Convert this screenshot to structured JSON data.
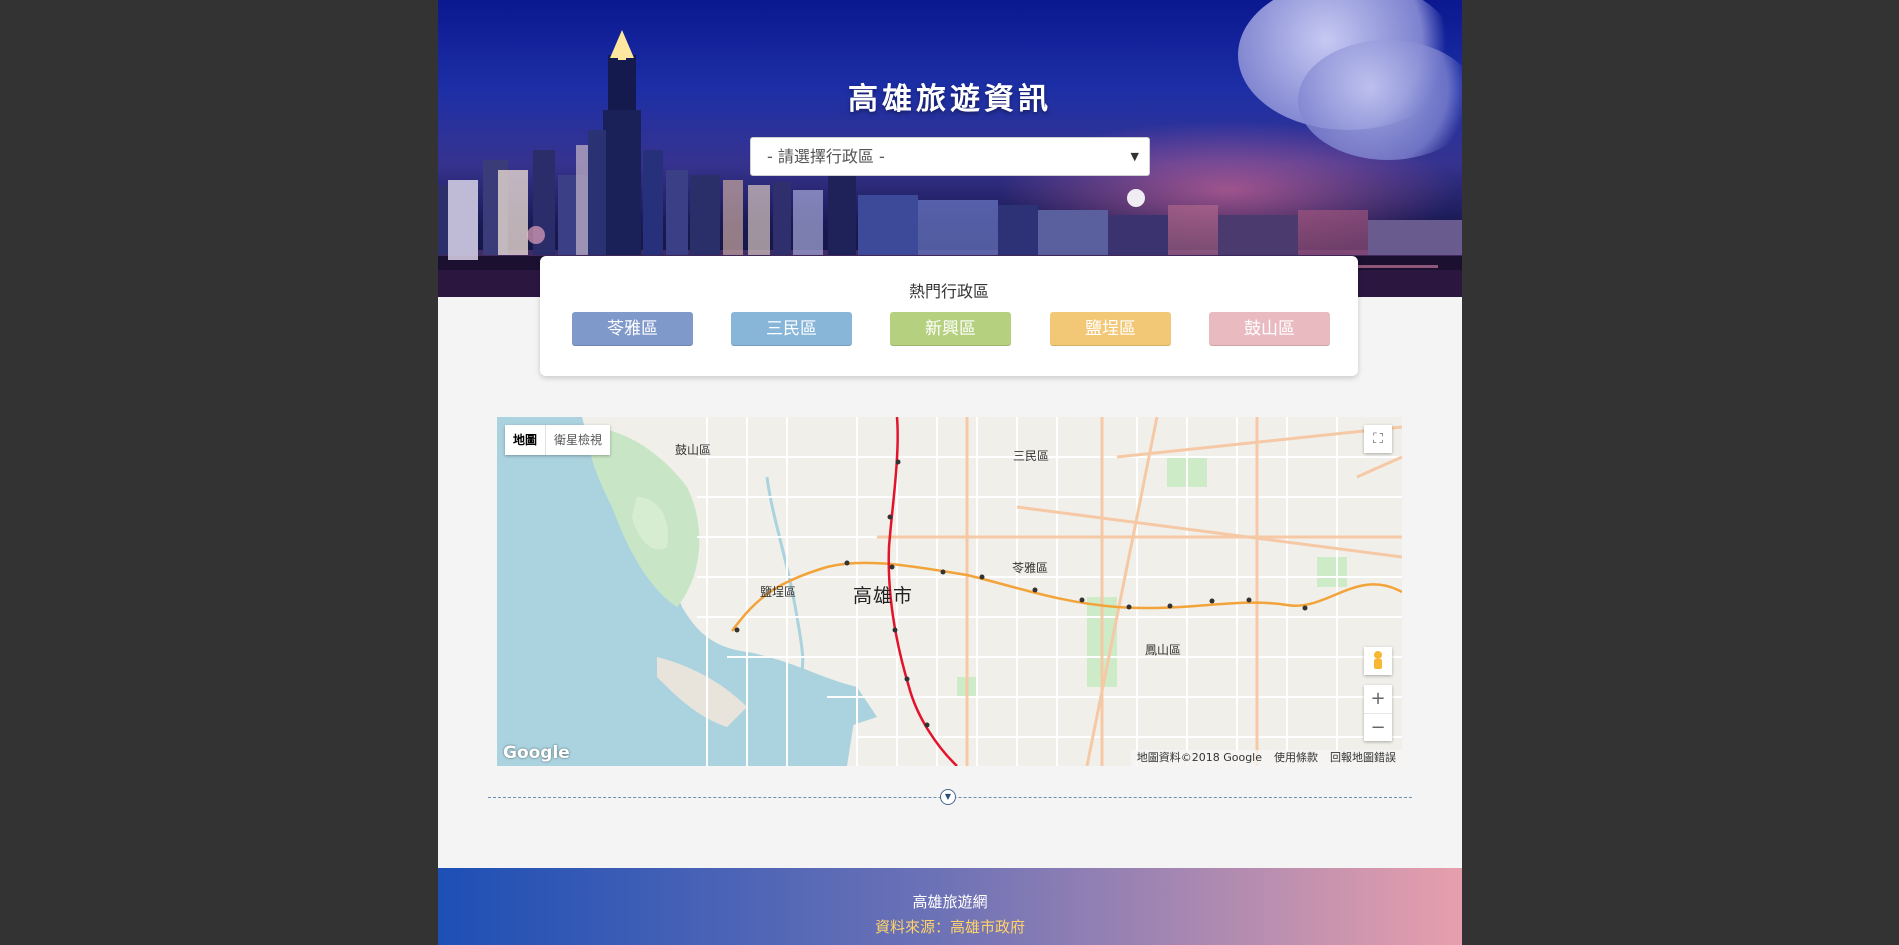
{
  "hero": {
    "title": "高雄旅遊資訊",
    "select_placeholder": "- 請選擇行政區 -",
    "select_arrow": "▼"
  },
  "popular": {
    "title": "熱門行政區",
    "districts": [
      {
        "label": "苓雅區",
        "color": "#8099cb"
      },
      {
        "label": "三民區",
        "color": "#87b6d9"
      },
      {
        "label": "新興區",
        "color": "#b5d07f"
      },
      {
        "label": "鹽埕區",
        "color": "#f2c876"
      },
      {
        "label": "鼓山區",
        "color": "#e9bbc0"
      }
    ]
  },
  "map": {
    "type_map": "地圖",
    "type_satellite": "衛星檢視",
    "fullscreen_icon": "⛶",
    "zoom_in": "+",
    "zoom_out": "−",
    "labels": {
      "gushan": "鼓山區",
      "sanmin": "三民區",
      "city": "高雄市",
      "lingya": "苓雅區",
      "yancheng": "鹽埕區",
      "fengshan": "鳳山區"
    },
    "google": "Google",
    "attribution": [
      "地圖資料©2018 Google",
      "使用條款",
      "回報地圖錯誤"
    ]
  },
  "footer": {
    "title": "高雄旅遊網",
    "source": "資料來源：高雄市政府"
  }
}
